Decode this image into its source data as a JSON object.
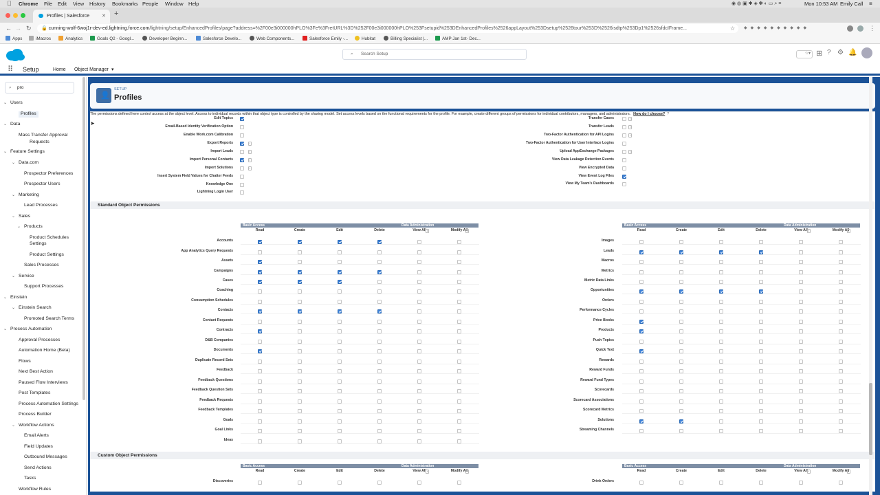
{
  "mac": {
    "apple": "",
    "menus": [
      "Chrome",
      "File",
      "Edit",
      "View",
      "History",
      "Bookmarks",
      "People",
      "Window",
      "Help"
    ],
    "clock": "Mon 10:53 AM",
    "user": "Emily Call"
  },
  "browser": {
    "tab_title": "Profiles | Salesforce",
    "new_tab": "+",
    "url_host": "cunning-wolf-6woj1r-dev-ed.lightning.force.com",
    "url_path": "/lightning/setup/EnhancedProfiles/page?address=%2F00e3i000000hPLO%3Fe%3FretURL%3D%252F00e3i000000hPLO%253Fsetupid%253DEnhancedProfiles%2526appLayout%253Dsetup%2526tour%253D%2526isdtp%253Dp1%2526sfdcIFrame..."
  },
  "bookmarks": [
    "Apps",
    "iMacros",
    "Analytics",
    "Goals Q2 - Googl...",
    "Developer Beginn...",
    "Salesforce Develo...",
    "Web Components...",
    "Salesforce Emily -...",
    "Hubitat",
    "Billing Specialist |...",
    "AMP Jan 1st- Dec..."
  ],
  "sf": {
    "search_placeholder": "Search Setup",
    "app_name": "Setup",
    "tab_home": "Home",
    "tab_object_manager": "Object Manager"
  },
  "sidebar": {
    "search_value": "pro",
    "items": [
      "Users",
      "Profiles",
      "Data",
      "Mass Transfer Approval",
      "Requests",
      "Feature Settings",
      "Data.com",
      "Prospector Preferences",
      "Prospector Users",
      "Marketing",
      "Lead Processes",
      "Sales",
      "Products",
      "Product Schedules",
      "Settings",
      "Product Settings",
      "Sales Processes",
      "Service",
      "Support Processes",
      "Einstein",
      "Einstein Search",
      "Promoted Search Terms",
      "Process Automation",
      "Approval Processes",
      "Automation Home (Beta)",
      "Flows",
      "Next Best Action",
      "Paused Flow Interviews",
      "Post Templates",
      "Process Automation Settings",
      "Process Builder",
      "Workflow Actions",
      "Email Alerts",
      "Field Updates",
      "Outbound Messages",
      "Send Actions",
      "Tasks",
      "Workflow Rules"
    ]
  },
  "header": {
    "setup_label": "SETUP",
    "title": "Profiles"
  },
  "sys_perms_left": [
    {
      "label": "Edit Topics",
      "on": true,
      "info": false
    },
    {
      "label": "Email-Based Identity Verification Option",
      "on": false,
      "info": false
    },
    {
      "label": "Enable Work.com Calibration",
      "on": false,
      "info": false
    },
    {
      "label": "Export Reports",
      "on": true,
      "info": true
    },
    {
      "label": "Import Leads",
      "on": false,
      "info": true
    },
    {
      "label": "Import Personal Contacts",
      "on": true,
      "info": true
    },
    {
      "label": "Import Solutions",
      "on": false,
      "info": true
    },
    {
      "label": "Insert System Field Values for Chatter Feeds",
      "on": false,
      "info": false
    },
    {
      "label": "Knowledge One",
      "on": false,
      "info": false
    },
    {
      "label": "Lightning Login User",
      "on": false,
      "info": false
    }
  ],
  "sys_perms_right": [
    {
      "label": "Transfer Cases",
      "on": false,
      "info": true
    },
    {
      "label": "Transfer Leads",
      "on": false,
      "info": true
    },
    {
      "label": "Two-Factor Authentication for API Logins",
      "on": false,
      "info": true
    },
    {
      "label": "Two-Factor Authentication for User Interface Logins",
      "on": false,
      "info": false
    },
    {
      "label": "Upload AppExchange Packages",
      "on": false,
      "info": true
    },
    {
      "label": "View Data Leakage Detection Events",
      "on": false,
      "info": false
    },
    {
      "label": "View Encrypted Data",
      "on": false,
      "info": false
    },
    {
      "label": "View Event Log Files",
      "on": true,
      "info": false
    },
    {
      "label": "View My Team's Dashboards",
      "on": false,
      "info": false
    }
  ],
  "std_perms": {
    "title": "Standard Object Permissions",
    "description": "The permissions defined here control access at the object level. Access to individual records within that object type is controlled by the sharing model. Set access levels based on the functional requirements for the profile. For example, create different groups of permissions for individual contributors, managers, and administrators.",
    "how_link": "How do I choose?",
    "group_basic": "Basic Access",
    "group_admin": "Data Administration",
    "columns": [
      "Read",
      "Create",
      "Edit",
      "Delete",
      "View All",
      "Modify All"
    ],
    "left_rows": [
      {
        "label": "Accounts",
        "v": [
          1,
          1,
          1,
          1,
          0,
          0
        ]
      },
      {
        "label": "App Analytics Query Requests",
        "v": [
          0,
          0,
          0,
          0,
          0,
          0
        ]
      },
      {
        "label": "Assets",
        "v": [
          1,
          0,
          0,
          0,
          0,
          0
        ]
      },
      {
        "label": "Campaigns",
        "v": [
          1,
          1,
          1,
          1,
          0,
          0
        ]
      },
      {
        "label": "Cases",
        "v": [
          1,
          1,
          1,
          0,
          0,
          0
        ]
      },
      {
        "label": "Coaching",
        "v": [
          0,
          0,
          0,
          0,
          0,
          0
        ]
      },
      {
        "label": "Consumption Schedules",
        "v": [
          0,
          0,
          0,
          0,
          0,
          0
        ]
      },
      {
        "label": "Contacts",
        "v": [
          1,
          1,
          1,
          1,
          0,
          0
        ]
      },
      {
        "label": "Contact Requests",
        "v": [
          0,
          0,
          0,
          0,
          0,
          0
        ]
      },
      {
        "label": "Contracts",
        "v": [
          1,
          0,
          0,
          0,
          0,
          0
        ]
      },
      {
        "label": "D&B Companies",
        "v": [
          0,
          0,
          0,
          0,
          0,
          0
        ]
      },
      {
        "label": "Documents",
        "v": [
          1,
          0,
          0,
          0,
          0,
          0
        ]
      },
      {
        "label": "Duplicate Record Sets",
        "v": [
          0,
          0,
          0,
          0,
          0,
          0
        ]
      },
      {
        "label": "Feedback",
        "v": [
          0,
          0,
          0,
          0,
          0,
          0
        ]
      },
      {
        "label": "Feedback Questions",
        "v": [
          0,
          0,
          0,
          0,
          0,
          0
        ]
      },
      {
        "label": "Feedback Question Sets",
        "v": [
          0,
          0,
          0,
          0,
          0,
          0
        ]
      },
      {
        "label": "Feedback Requests",
        "v": [
          0,
          0,
          0,
          0,
          0,
          0
        ]
      },
      {
        "label": "Feedback Templates",
        "v": [
          0,
          0,
          0,
          0,
          0,
          0
        ]
      },
      {
        "label": "Goals",
        "v": [
          0,
          0,
          0,
          0,
          0,
          0
        ]
      },
      {
        "label": "Goal Links",
        "v": [
          0,
          0,
          0,
          0,
          0,
          0
        ]
      },
      {
        "label": "Ideas",
        "v": [
          0,
          0,
          0,
          0,
          0,
          0
        ]
      }
    ],
    "right_rows": [
      {
        "label": "Images",
        "v": [
          0,
          0,
          0,
          0,
          0,
          0
        ]
      },
      {
        "label": "Leads",
        "v": [
          1,
          1,
          1,
          1,
          0,
          0
        ]
      },
      {
        "label": "Macros",
        "v": [
          0,
          0,
          0,
          0,
          0,
          0
        ]
      },
      {
        "label": "Metrics",
        "v": [
          0,
          0,
          0,
          0,
          0,
          0
        ]
      },
      {
        "label": "Metric Data Links",
        "v": [
          0,
          0,
          0,
          0,
          0,
          0
        ]
      },
      {
        "label": "Opportunities",
        "v": [
          1,
          1,
          1,
          1,
          0,
          0
        ]
      },
      {
        "label": "Orders",
        "v": [
          0,
          0,
          0,
          0,
          0,
          0
        ]
      },
      {
        "label": "Performance Cycles",
        "v": [
          0,
          0,
          0,
          0,
          0,
          0
        ]
      },
      {
        "label": "Price Books",
        "v": [
          1,
          0,
          0,
          0,
          0,
          0
        ]
      },
      {
        "label": "Products",
        "v": [
          1,
          0,
          0,
          0,
          0,
          0
        ]
      },
      {
        "label": "Push Topics",
        "v": [
          0,
          0,
          0,
          0,
          0,
          0
        ]
      },
      {
        "label": "Quick Text",
        "v": [
          1,
          0,
          0,
          0,
          0,
          0
        ]
      },
      {
        "label": "Rewards",
        "v": [
          0,
          0,
          0,
          0,
          0,
          0
        ]
      },
      {
        "label": "Reward Funds",
        "v": [
          0,
          0,
          0,
          0,
          0,
          0
        ]
      },
      {
        "label": "Reward Fund Types",
        "v": [
          0,
          0,
          0,
          0,
          0,
          0
        ]
      },
      {
        "label": "Scorecards",
        "v": [
          0,
          0,
          0,
          0,
          0,
          0
        ]
      },
      {
        "label": "Scorecard Associations",
        "v": [
          0,
          0,
          0,
          0,
          0,
          0
        ]
      },
      {
        "label": "Scorecard Metrics",
        "v": [
          0,
          0,
          0,
          0,
          0,
          0
        ]
      },
      {
        "label": "Solutions",
        "v": [
          1,
          1,
          0,
          0,
          0,
          0
        ]
      },
      {
        "label": "Streaming Channels",
        "v": [
          0,
          0,
          0,
          0,
          0,
          0
        ]
      }
    ]
  },
  "custom_perms": {
    "title": "Custom Object Permissions",
    "left_rows": [
      {
        "label": "Discoveries"
      }
    ],
    "right_rows": [
      {
        "label": "Drink Orders"
      }
    ]
  },
  "colors": {
    "brand_blue": "#1b5297",
    "checkbox_blue": "#3a7fd6",
    "header_bar": "#7d8ea5",
    "sf_cloud": "#00a1e0"
  }
}
